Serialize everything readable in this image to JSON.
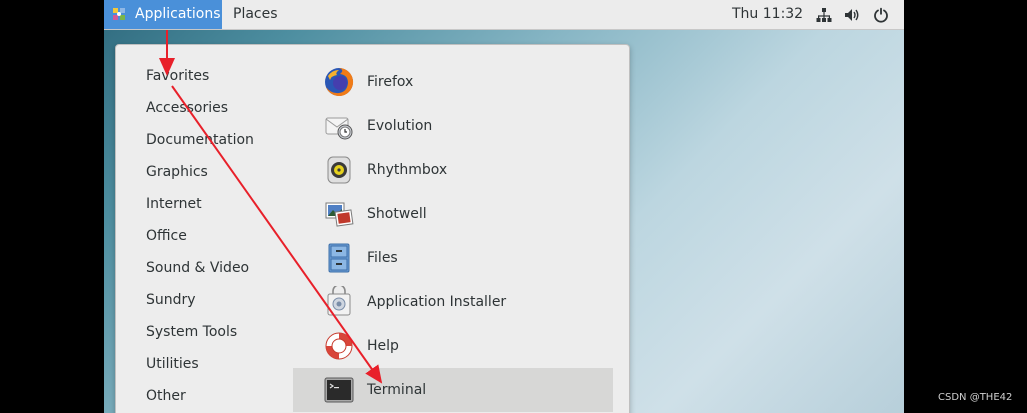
{
  "topbar": {
    "applications_label": "Applications",
    "places_label": "Places",
    "clock": "Thu 11:32"
  },
  "menu": {
    "categories": [
      {
        "label": "Favorites"
      },
      {
        "label": "Accessories"
      },
      {
        "label": "Documentation"
      },
      {
        "label": "Graphics"
      },
      {
        "label": "Internet"
      },
      {
        "label": "Office"
      },
      {
        "label": "Sound & Video"
      },
      {
        "label": "Sundry"
      },
      {
        "label": "System Tools"
      },
      {
        "label": "Utilities"
      },
      {
        "label": "Other"
      }
    ],
    "apps": [
      {
        "label": "Firefox",
        "icon": "firefox-icon"
      },
      {
        "label": "Evolution",
        "icon": "evolution-icon"
      },
      {
        "label": "Rhythmbox",
        "icon": "rhythmbox-icon"
      },
      {
        "label": "Shotwell",
        "icon": "shotwell-icon"
      },
      {
        "label": "Files",
        "icon": "files-icon"
      },
      {
        "label": "Application Installer",
        "icon": "software-icon"
      },
      {
        "label": "Help",
        "icon": "help-icon"
      },
      {
        "label": "Terminal",
        "icon": "terminal-icon",
        "selected": true
      }
    ]
  },
  "tray_icons": [
    "network-icon",
    "volume-icon",
    "power-icon"
  ],
  "colors": {
    "accent": "#4a90d9",
    "topbar_bg": "#ececec",
    "menu_bg": "#ededed",
    "selected_bg": "#d7d7d6",
    "annotation_arrow": "#e8202a"
  },
  "watermark": "CSDN @THE42"
}
